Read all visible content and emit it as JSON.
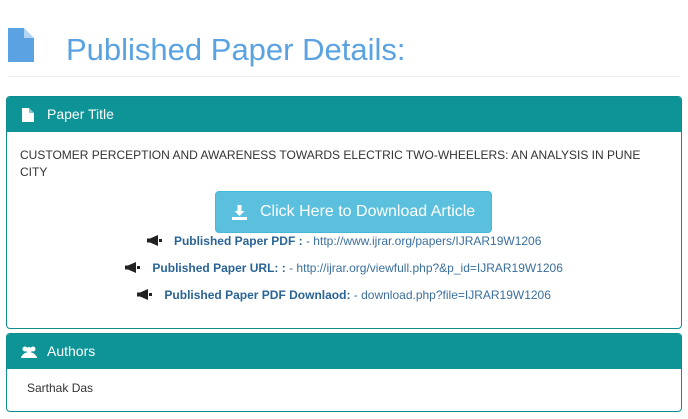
{
  "page_heading": {
    "icon": "file-document-icon",
    "title": "Published Paper Details:",
    "color": "#5aa2e2"
  },
  "paper_panel": {
    "heading_icon": "file-icon",
    "heading": "Paper Title",
    "header_color": "#0e9497",
    "paper_title": "CUSTOMER PERCEPTION AND AWARENESS TOWARDS ELECTRIC TWO-WHEELERS: AN ANALYSIS IN PUNE CITY",
    "download_button": {
      "icon": "download-icon",
      "label": "Click Here to Download Article",
      "color": "#5bc0de"
    },
    "links": [
      {
        "icon": "bullhorn-icon",
        "label": "Published Paper PDF :",
        "value": " - http://www.ijrar.org/papers/IJRAR19W1206"
      },
      {
        "icon": "bullhorn-icon",
        "label": "Published Paper URL: :",
        "value": " - http://ijrar.org/viewfull.php?&p_id=IJRAR19W1206"
      },
      {
        "icon": "bullhorn-icon",
        "label": "Published Paper PDF Downlaod:",
        "value": " - download.php?file=IJRAR19W1206"
      }
    ]
  },
  "authors_panel": {
    "heading_icon": "users-icon",
    "heading": "Authors",
    "authors": [
      "Sarthak Das"
    ]
  }
}
